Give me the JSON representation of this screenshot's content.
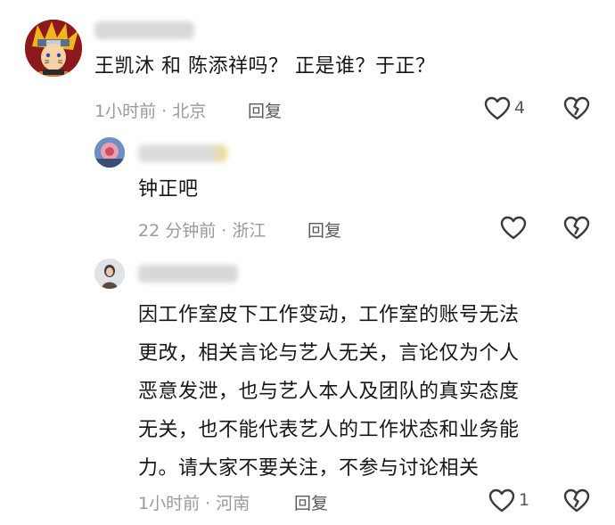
{
  "comments": [
    {
      "text": "王凯沐 和 陈添祥吗？ 正是谁？于正？",
      "time": "1小时前",
      "location": "北京",
      "reply_label": "回复",
      "like_count": "4"
    },
    {
      "text": "钟正吧",
      "time": "22 分钟前",
      "location": "浙江",
      "reply_label": "回复",
      "like_count": ""
    },
    {
      "text_lines": [
        "因工作室皮下工作变动，工作室的账号无法",
        "更改，相关言论与艺人无关，言论仅为个人",
        "恶意发泄，也与艺人本人及团队的真实态度",
        "无关，也不能代表艺人的工作状态和业务能",
        "力。请大家不要关注，不参与讨论相关"
      ],
      "time": "1小时前",
      "location": "河南",
      "reply_label": "回复",
      "like_count": "1"
    }
  ],
  "separator": "·",
  "icons": [
    "heart-outline-icon",
    "broken-heart-icon",
    "naruto-avatar",
    "blurred-username"
  ]
}
